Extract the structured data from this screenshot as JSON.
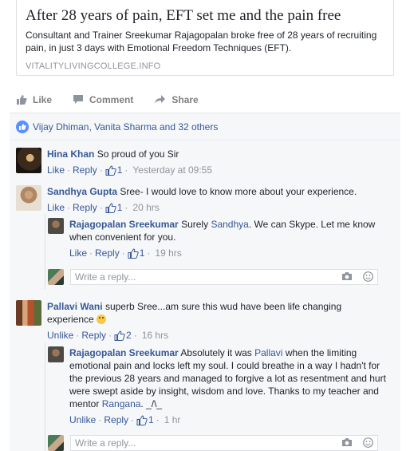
{
  "link_preview": {
    "title": "After 28 years of pain, EFT set me and the pain free",
    "description": "Consultant and Trainer Sreekumar Rajagopalan broke free of 28 years of recruiting pain, in just 3 days with Emotional Freedom Techniques (EFT).",
    "domain": "VITALITYLIVINGCOLLEGE.INFO"
  },
  "actions": {
    "like": "Like",
    "comment": "Comment",
    "share": "Share"
  },
  "likes_summary": "Vijay Dhiman, Vanita Sharma and 32 others",
  "comments": [
    {
      "author": "Hina Khan",
      "text": "So proud of you Sir",
      "like": "Like",
      "reply": "Reply",
      "likes": "1",
      "time": "Yesterday at 09:55"
    },
    {
      "author": "Sandhya Gupta",
      "text": "Sree- I would love to know more about your experience.",
      "like": "Like",
      "reply": "Reply",
      "likes": "1",
      "time": "20 hrs",
      "replies": [
        {
          "author": "Rajagopalan Sreekumar",
          "text_before": "Surely",
          "mention": "Sandhya",
          "text_after": ". We can Skype. Let me know when convenient for you.",
          "like": "Like",
          "reply": "Reply",
          "likes": "1",
          "time": "19 hrs"
        }
      ]
    },
    {
      "author": "Pallavi Wani",
      "text": "superb Sree...am sure this wud have been life changing experience",
      "like": "Unlike",
      "reply": "Reply",
      "likes": "2",
      "time": "16 hrs",
      "replies": [
        {
          "author": "Rajagopalan Sreekumar",
          "text_before": "Absolutely it was",
          "mention": "Pallavi",
          "text_mid": "when the limiting emotional pain and locks left my soul. I could breathe in a way I hadn't for the previous 28 years and managed to forgive a lot as resentment and hurt were swept aside by insight, wisdom and love. Thanks to my teacher and mentor",
          "mention2": "Rangana",
          "text_after": ". _/\\_",
          "like": "Unlike",
          "reply": "Reply",
          "likes": "1",
          "time": "1 hr"
        }
      ]
    }
  ],
  "reply_placeholder": "Write a reply...",
  "icons": {
    "camera": "camera-icon",
    "emoji": "emoji-icon",
    "like": "thumbs-up-icon"
  },
  "colors": {
    "link": "#365899",
    "muted": "#90949c",
    "border": "#dddfe2"
  }
}
